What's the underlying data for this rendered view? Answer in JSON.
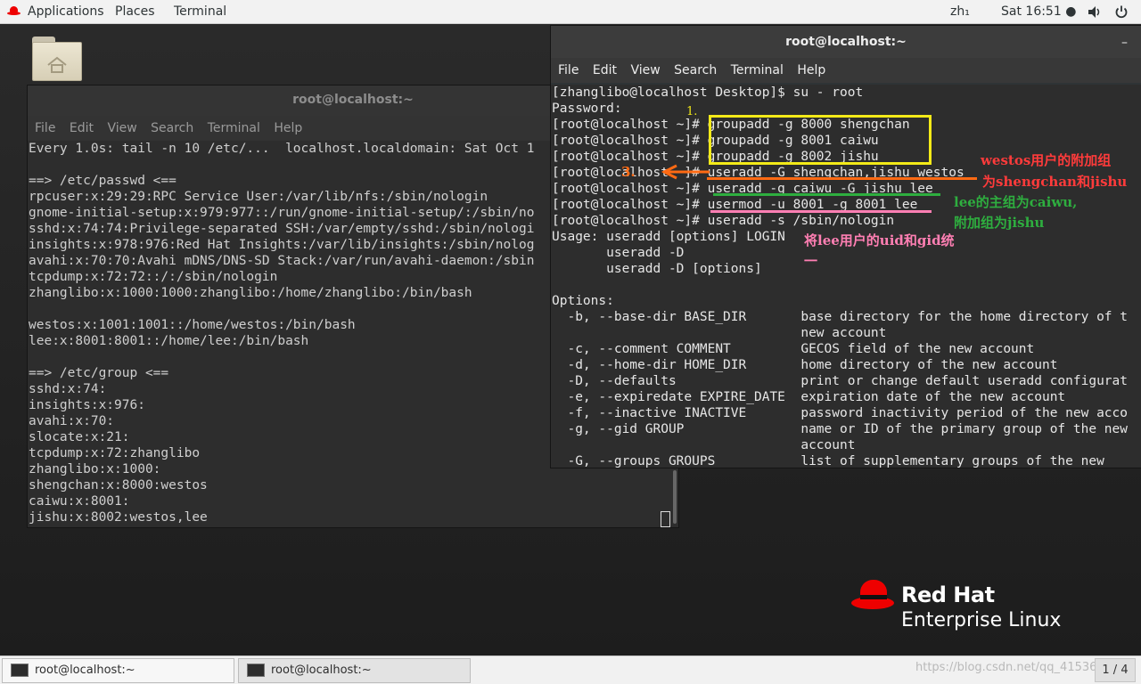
{
  "topbar": {
    "applications": "Applications",
    "places": "Places",
    "terminal": "Terminal",
    "input_method": "zh₁",
    "clock": "Sat 16:51 ●",
    "icons": [
      "speaker-icon",
      "power-icon"
    ]
  },
  "left_window": {
    "title": "root@localhost:~",
    "menu": [
      "File",
      "Edit",
      "View",
      "Search",
      "Terminal",
      "Help"
    ],
    "lines": [
      "Every 1.0s: tail -n 10 /etc/...  localhost.localdomain: Sat Oct 1",
      "",
      "==> /etc/passwd <==",
      "rpcuser:x:29:29:RPC Service User:/var/lib/nfs:/sbin/nologin",
      "gnome-initial-setup:x:979:977::/run/gnome-initial-setup/:/sbin/no",
      "sshd:x:74:74:Privilege-separated SSH:/var/empty/sshd:/sbin/nologi",
      "insights:x:978:976:Red Hat Insights:/var/lib/insights:/sbin/nolog",
      "avahi:x:70:70:Avahi mDNS/DNS-SD Stack:/var/run/avahi-daemon:/sbin",
      "tcpdump:x:72:72::/:/sbin/nologin",
      "zhanglibo:x:1000:1000:zhanglibo:/home/zhanglibo:/bin/bash",
      "",
      "westos:x:1001:1001::/home/westos:/bin/bash",
      "lee:x:8001:8001::/home/lee:/bin/bash",
      "",
      "==> /etc/group <==",
      "sshd:x:74:",
      "insights:x:976:",
      "avahi:x:70:",
      "slocate:x:21:",
      "tcpdump:x:72:zhanglibo",
      "zhanglibo:x:1000:",
      "shengchan:x:8000:westos",
      "caiwu:x:8001:",
      "jishu:x:8002:westos,lee"
    ]
  },
  "right_window": {
    "title": "root@localhost:~",
    "menu": [
      "File",
      "Edit",
      "View",
      "Search",
      "Terminal",
      "Help"
    ],
    "lines": [
      "[zhanglibo@localhost Desktop]$ su - root",
      "Password:",
      "[root@localhost ~]# groupadd -g 8000 shengchan",
      "[root@localhost ~]# groupadd -g 8001 caiwu",
      "[root@localhost ~]# groupadd -g 8002 jishu",
      "[root@localhost ~]# useradd -G shengchan,jishu westos",
      "[root@localhost ~]# useradd -g caiwu -G jishu lee",
      "[root@localhost ~]# usermod -u 8001 -g 8001 lee",
      "[root@localhost ~]# useradd -s /sbin/nologin",
      "Usage: useradd [options] LOGIN",
      "       useradd -D",
      "       useradd -D [options]",
      "",
      "Options:",
      "  -b, --base-dir BASE_DIR       base directory for the home directory of t",
      "                                new account",
      "  -c, --comment COMMENT         GECOS field of the new account",
      "  -d, --home-dir HOME_DIR       home directory of the new account",
      "  -D, --defaults                print or change default useradd configurat",
      "  -e, --expiredate EXPIRE_DATE  expiration date of the new account",
      "  -f, --inactive INACTIVE       password inactivity period of the new acco",
      "  -g, --gid GROUP               name or ID of the primary group of the new",
      "                                account",
      "  -G, --groups GROUPS           list of supplementary groups of the new"
    ]
  },
  "annotations": {
    "step1": "1.",
    "step3": "3.",
    "westos_note_1": "westos用户的附加组",
    "westos_note_2": "为shengchan和jishu",
    "lee_note_1": "lee的主组为caiwu,",
    "lee_note_2": "附加组为jishu",
    "uid_note_1": "将lee用户的uid和gid统",
    "uid_note_2": "一",
    "colors": {
      "yellow": "#f3ea18",
      "orange": "#ff6a13",
      "green": "#2eae3f",
      "pink": "#ff7fb3",
      "red": "#ff3b3b"
    }
  },
  "logo": {
    "line1": "Red Hat",
    "line2": "Enterprise Linux"
  },
  "taskbar": {
    "tasks": [
      "root@localhost:~",
      "root@localhost:~"
    ],
    "watermark": "https://blog.csdn.net/qq_41536",
    "pager": "1 / 4"
  }
}
